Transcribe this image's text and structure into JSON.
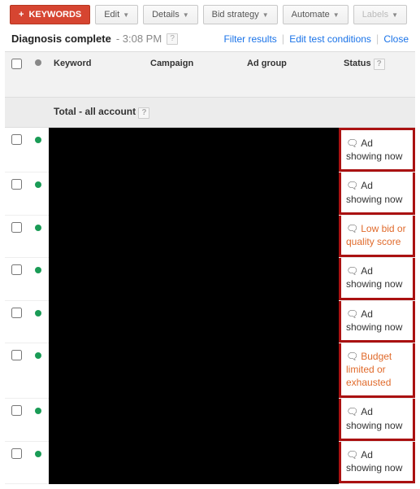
{
  "toolbar": {
    "keywords_btn": "Keywords",
    "edit_btn": "Edit",
    "details_btn": "Details",
    "bid_btn": "Bid strategy",
    "automate_btn": "Automate",
    "labels_btn": "Labels"
  },
  "info": {
    "title": "Diagnosis complete",
    "time": "- 3:08 PM",
    "filter": "Filter results",
    "edit": "Edit test conditions",
    "close": "Close"
  },
  "cols": {
    "keyword": "Keyword",
    "campaign": "Campaign",
    "adgroup": "Ad group",
    "status": "Status"
  },
  "totals": "Total - all account",
  "rows": [
    {
      "status": "Ad showing now",
      "warn": false
    },
    {
      "status": "Ad showing now",
      "warn": false
    },
    {
      "status": "Low bid or quality score",
      "warn": true
    },
    {
      "status": "Ad showing now",
      "warn": false
    },
    {
      "status": "Ad showing now",
      "warn": false
    },
    {
      "status": "Budget limited or exhausted",
      "warn": true
    },
    {
      "status": "Ad showing now",
      "warn": false
    },
    {
      "status": "Ad showing now",
      "warn": false
    }
  ]
}
